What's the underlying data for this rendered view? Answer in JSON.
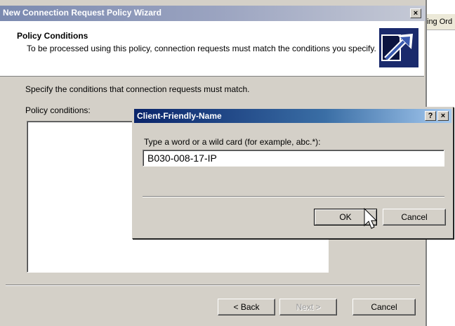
{
  "background_window": {
    "partial_text": "ing Ord"
  },
  "wizard": {
    "title": "New Connection Request Policy Wizard",
    "close_glyph": "×",
    "heading": "Policy Conditions",
    "description": "To be processed using this policy, connection requests must match the conditions you specify.",
    "body_text": "Specify the conditions that connection requests must match.",
    "conditions_label": "Policy conditions:",
    "conditions": [],
    "buttons": {
      "back": "< Back",
      "next": "Next >",
      "cancel": "Cancel"
    }
  },
  "dialog": {
    "title": "Client-Friendly-Name",
    "help_glyph": "?",
    "close_glyph": "×",
    "prompt": "Type a word or a wild card (for example, abc.*):",
    "input_value": "B030-008-17-IP",
    "buttons": {
      "ok": "OK",
      "cancel": "Cancel"
    }
  },
  "colors": {
    "dialog_title_bar": "#0a246a",
    "wizard_title_bar_inactive": "#7b8ab0",
    "window_face": "#d4d0c8",
    "wizard_logo": "#1a2a6c"
  },
  "icons": [
    "wizard-arrow-logo-icon",
    "mouse-pointer-icon"
  ]
}
